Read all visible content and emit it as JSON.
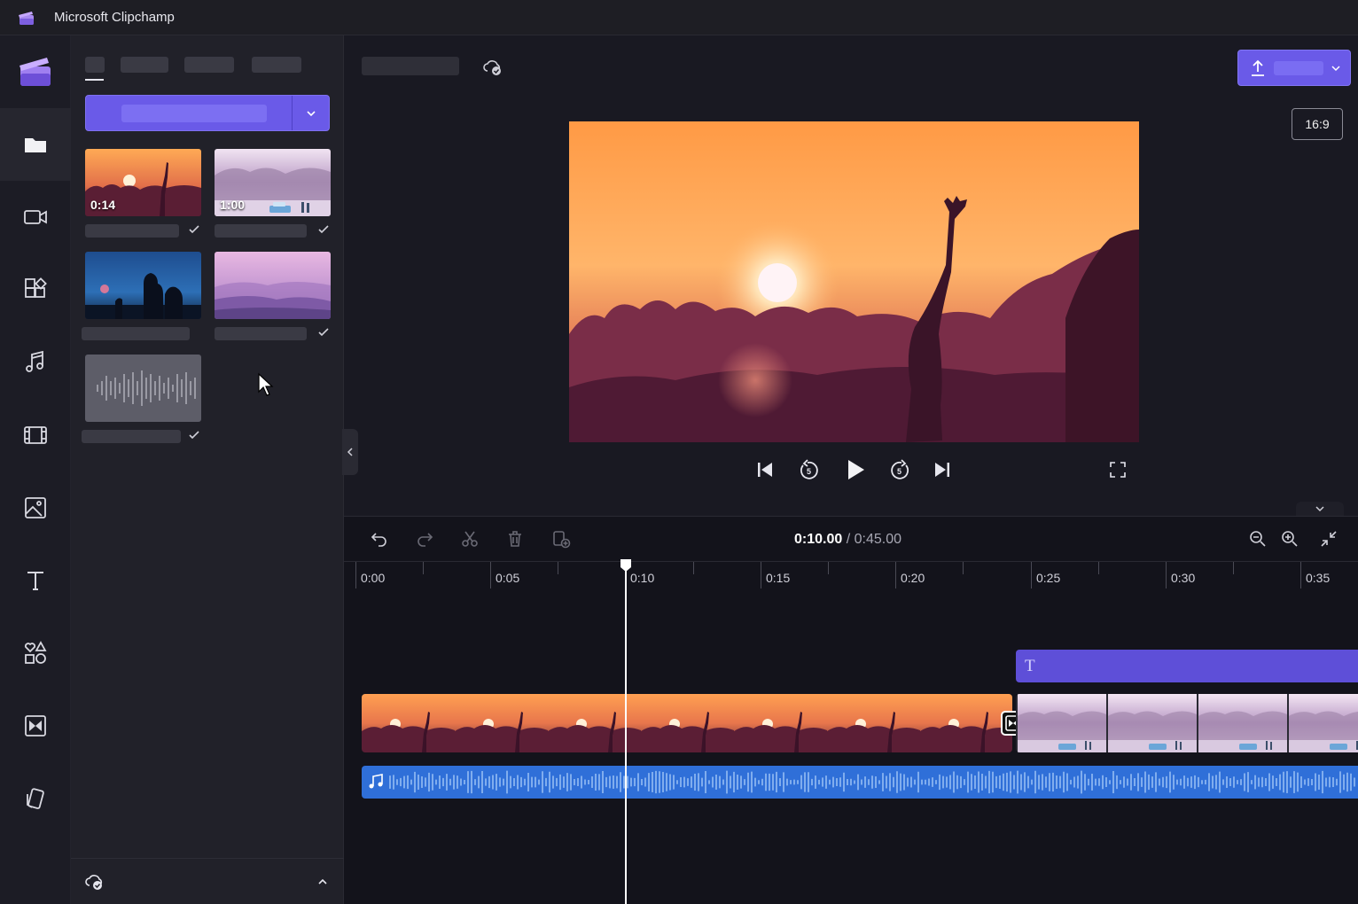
{
  "app": {
    "title": "Microsoft Clipchamp"
  },
  "sidebar": {
    "items": [
      {
        "id": "your-media",
        "icon": "folder-icon",
        "active": true
      },
      {
        "id": "record-create",
        "icon": "camera-icon"
      },
      {
        "id": "templates",
        "icon": "templates-icon"
      },
      {
        "id": "music",
        "icon": "music-icon"
      },
      {
        "id": "stock-video",
        "icon": "film-icon"
      },
      {
        "id": "stock-images",
        "icon": "image-icon"
      },
      {
        "id": "text",
        "icon": "text-icon"
      },
      {
        "id": "graphics",
        "icon": "shapes-icon"
      },
      {
        "id": "transitions",
        "icon": "transition-icon"
      },
      {
        "id": "brand-kit",
        "icon": "brand-kit-icon"
      }
    ]
  },
  "media": {
    "items": [
      {
        "duration": "0:14",
        "type": "video",
        "checked": true
      },
      {
        "duration": "1:00",
        "type": "video",
        "checked": true
      },
      {
        "duration": "",
        "type": "video",
        "checked": false
      },
      {
        "duration": "",
        "type": "video",
        "checked": true
      },
      {
        "duration": "",
        "type": "audio",
        "checked": true
      }
    ]
  },
  "preview": {
    "aspect_ratio": "16:9"
  },
  "timeline": {
    "current_time": "0:10.00",
    "separator": " / ",
    "total_time": "0:45.00",
    "ticks": [
      "0:00",
      "0:05",
      "0:10",
      "0:15",
      "0:20",
      "0:25",
      "0:30",
      "0:35"
    ],
    "text_clip_glyph": "T"
  },
  "colors": {
    "accent": "#6a5ae8",
    "audio": "#2f6fd8",
    "text_clip": "#5e4fd8"
  }
}
